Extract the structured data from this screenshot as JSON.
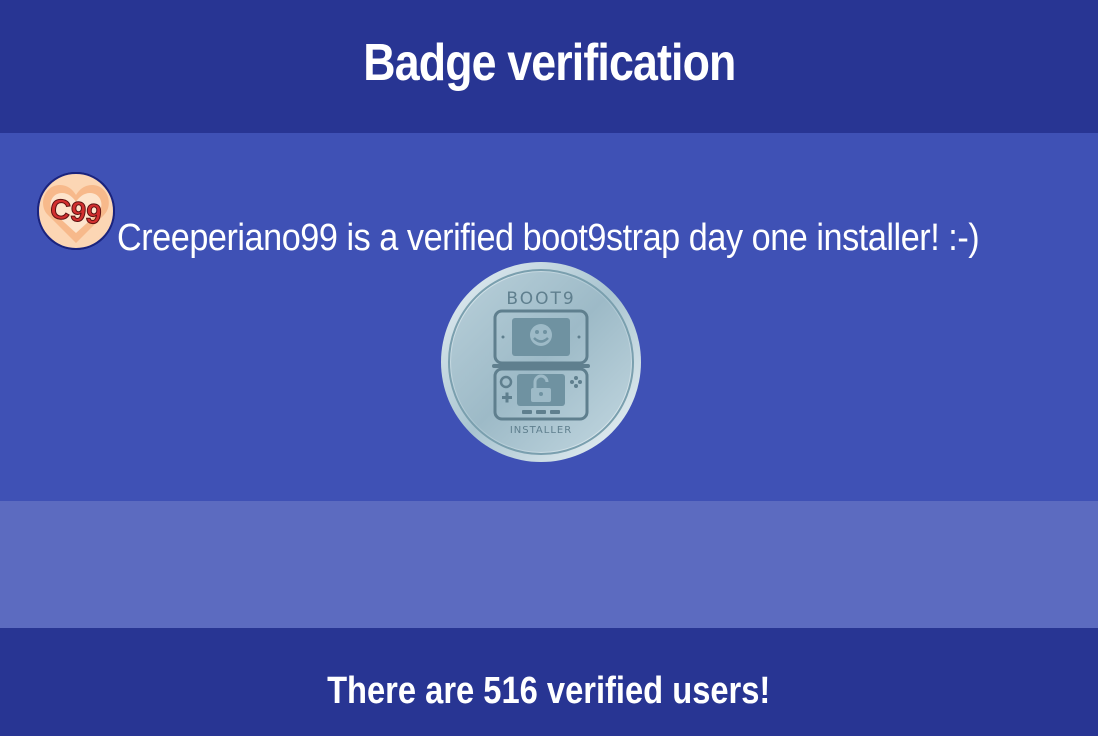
{
  "header": {
    "title": "Badge verification"
  },
  "verification": {
    "avatar_icon": "c99-heart-avatar-icon",
    "avatar_text": "C99",
    "message": "Creeperiano99 is a verified boot9strap day one installer! :-)"
  },
  "badge": {
    "icon": "boot9-installer-badge-icon",
    "top_text": "BOOT9",
    "bottom_text": "INSTALLER"
  },
  "footer": {
    "text": "There are 516 verified users!"
  },
  "colors": {
    "header_bg": "#283593",
    "main_bg": "#3f51b5",
    "spacer_bg": "#5c6bc0",
    "footer_bg": "#283593",
    "text": "#ffffff"
  }
}
